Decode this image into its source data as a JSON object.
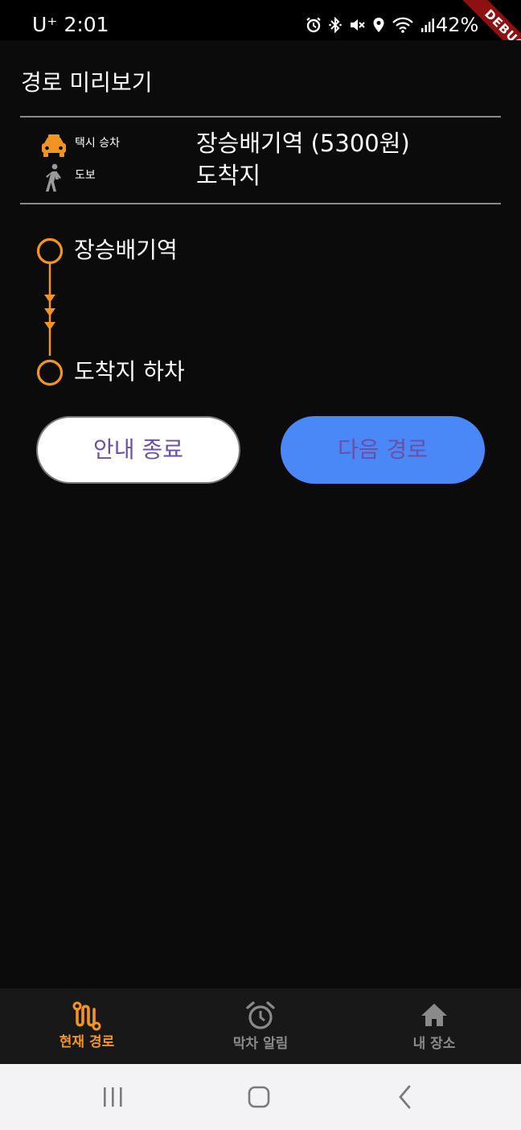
{
  "status_bar": {
    "carrier_time": "U⁺ 2:01",
    "battery": "42%",
    "debug_banner": "DEBUG",
    "icons": [
      "alarm-icon",
      "bluetooth-icon",
      "mute-icon",
      "location-icon",
      "wifi-icon",
      "signal-icon"
    ]
  },
  "header": {
    "title": "경로 미리보기"
  },
  "summary": {
    "taxi": {
      "icon": "taxi-icon",
      "label": "택시 승차",
      "value": "장승배기역 (5300원)"
    },
    "walk": {
      "icon": "walk-icon",
      "label": "도보",
      "value": "도착지"
    }
  },
  "timeline": {
    "start": "장승배기역",
    "end": "도착지 하차"
  },
  "buttons": {
    "end_guide": "안내 종료",
    "next_route": "다음 경로"
  },
  "bottom_nav": {
    "items": [
      {
        "label": "현재 경로",
        "icon": "route-icon",
        "active": true
      },
      {
        "label": "막차 알림",
        "icon": "alarm-clock-icon",
        "active": false
      },
      {
        "label": "내 장소",
        "icon": "home-icon",
        "active": false
      }
    ]
  },
  "system_nav": {
    "buttons": [
      "recents-icon",
      "home-button-icon",
      "back-icon"
    ]
  },
  "colors": {
    "background": "#0b0b0b",
    "accent_orange": "#f29422",
    "button_blue": "#4a87f7",
    "button_text_purple": "#6a4fa5",
    "nav_inactive": "#8a8a8a",
    "debug_red": "#8e1111"
  }
}
